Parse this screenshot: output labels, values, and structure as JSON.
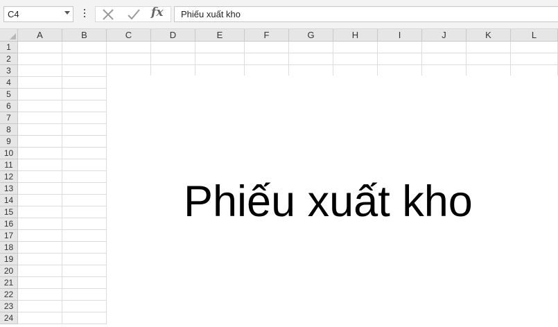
{
  "formula_bar": {
    "name_box_value": "C4",
    "cancel_icon": "close-icon",
    "enter_icon": "checkmark-icon",
    "function_label": "fx",
    "formula_text": "Phiếu xuất kho"
  },
  "sheet": {
    "columns": [
      "A",
      "B",
      "C",
      "D",
      "E",
      "F",
      "G",
      "H",
      "I",
      "J",
      "K",
      "L"
    ],
    "rows": [
      "1",
      "2",
      "3",
      "4",
      "5",
      "6",
      "7",
      "8",
      "9",
      "10",
      "11",
      "12",
      "13",
      "14",
      "15",
      "16",
      "17",
      "18",
      "19",
      "20",
      "21",
      "22",
      "23",
      "24"
    ],
    "selected_cell": "C4"
  },
  "text_shape": {
    "text": "Phiếu xuất kho"
  }
}
